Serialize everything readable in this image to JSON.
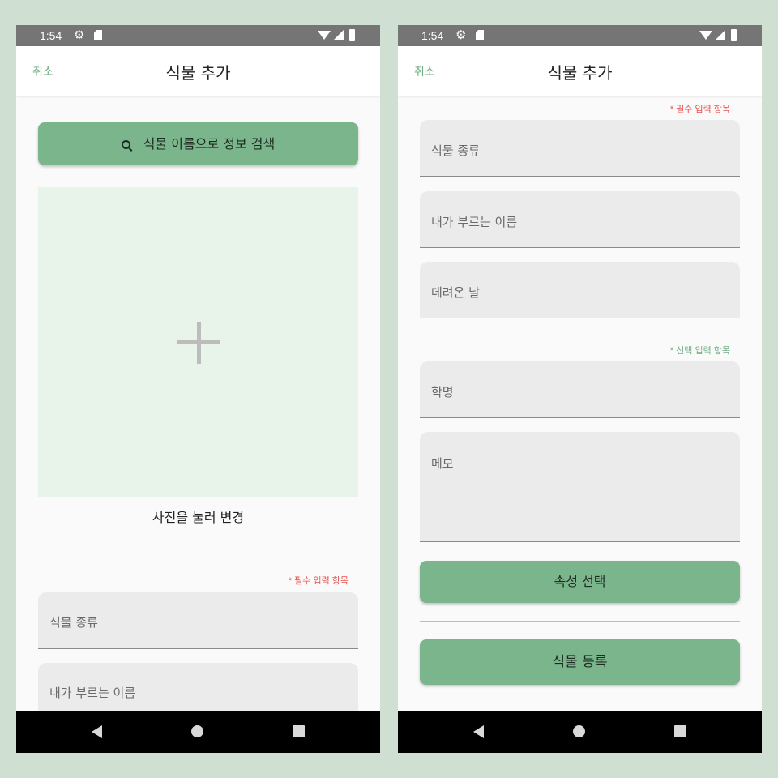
{
  "status_bar": {
    "time": "1:54",
    "gear_icon": "⚙"
  },
  "app_bar": {
    "cancel_label": "취소",
    "title": "식물 추가"
  },
  "left_screen": {
    "search_button_label": "식물 이름으로 정보 검색",
    "photo_caption": "사진을 눌러 변경",
    "required_label": "* 필수 입력 항목",
    "fields": [
      {
        "placeholder": "식물 종류"
      },
      {
        "placeholder": "내가 부르는 이름"
      }
    ]
  },
  "right_screen": {
    "required_label": "* 필수 입력 항목",
    "required_fields": [
      {
        "placeholder": "식물 종류"
      },
      {
        "placeholder": "내가 부르는 이름"
      },
      {
        "placeholder": "데려온 날"
      }
    ],
    "optional_label": "* 선택 입력 항목",
    "optional_fields": [
      {
        "placeholder": "학명"
      },
      {
        "placeholder": "메모"
      }
    ],
    "attribute_button_label": "속성 선택",
    "register_button_label": "식물 등록"
  },
  "colors": {
    "accent_green": "#7ab58c",
    "required_red": "#e85050",
    "optional_green": "#6fae85",
    "photo_bg": "#e8f3e9"
  },
  "icons": [
    "gear-icon",
    "sdcard-icon",
    "wifi-icon",
    "signal-icon",
    "battery-icon",
    "search-icon",
    "plus-icon",
    "back-icon",
    "home-icon",
    "recents-icon"
  ]
}
